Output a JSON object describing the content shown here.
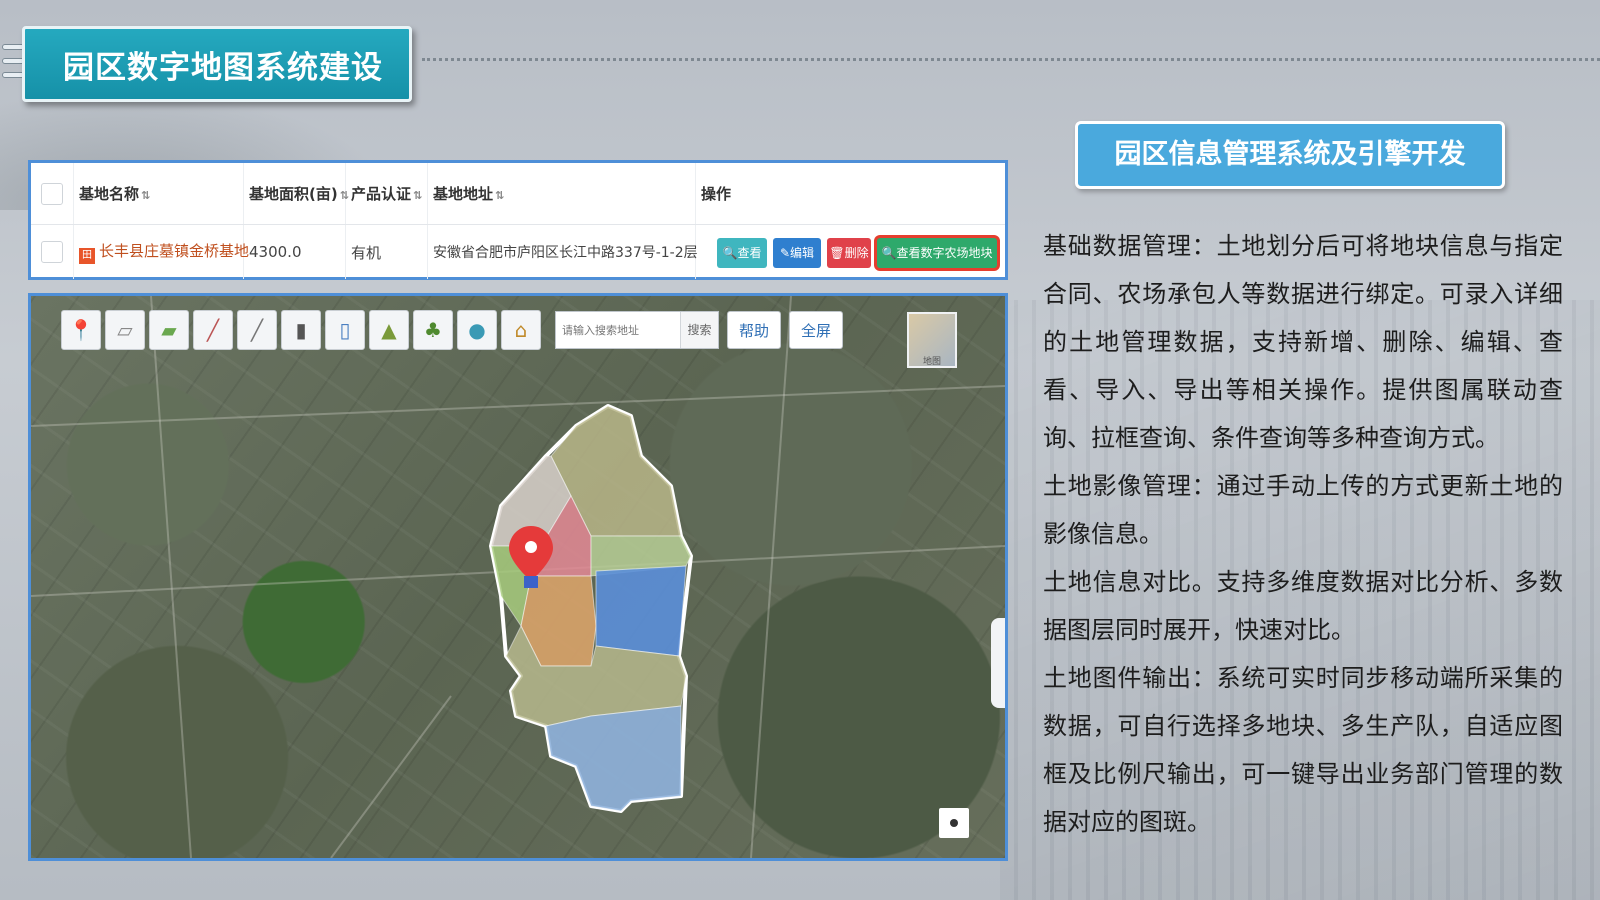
{
  "slide_title": "园区数字地图系统建设",
  "section_title": "园区信息管理系统及引擎开发",
  "table": {
    "headers": [
      "基地名称",
      "基地面积(亩)",
      "产品认证",
      "基地地址",
      "操作"
    ],
    "row": {
      "name": "长丰县庄墓镇金桥基地",
      "area": "4300.0",
      "certification": "有机",
      "address": "安徽省合肥市庐阳区长江中路337号-1-2层",
      "actions": [
        "查看",
        "编辑",
        "删除",
        "查看数字农场地块"
      ]
    }
  },
  "map": {
    "tools": [
      "marker-tool",
      "polygon-tool",
      "field-tool",
      "road-tool",
      "railway-tool",
      "highway-tool",
      "building-tool",
      "mountain-tool",
      "tree-tool",
      "pond-tool",
      "farm-tool"
    ],
    "search_placeholder": "请输入搜索地址",
    "search_label": "搜索",
    "help_label": "帮助",
    "fullscreen_label": "全屏",
    "minimap_label": "地图"
  },
  "description": [
    "基础数据管理：土地划分后可将地块信息与指定合同、农场承包人等数据进行绑定。可录入详细的土地管理数据，支持新增、删除、编辑、查看、导入、导出等相关操作。提供图属联动查询、拉框查询、条件查询等多种查询方式。",
    "土地影像管理：通过手动上传的方式更新土地的影像信息。",
    "土地信息对比。支持多维度数据对比分析、多数据图层同时展开，快速对比。",
    "土地图件输出：系统可实时同步移动端所采集的数据，可自行选择多地块、多生产队，自适应图框及比例尺输出，可一键导出业务部门管理的数据对应的图斑。"
  ],
  "colors": {
    "title_teal": "#1f9fb5",
    "section_blue": "#4aa9dd",
    "panel_border": "#4e8fd8",
    "highlight_red": "#e53e2e"
  }
}
